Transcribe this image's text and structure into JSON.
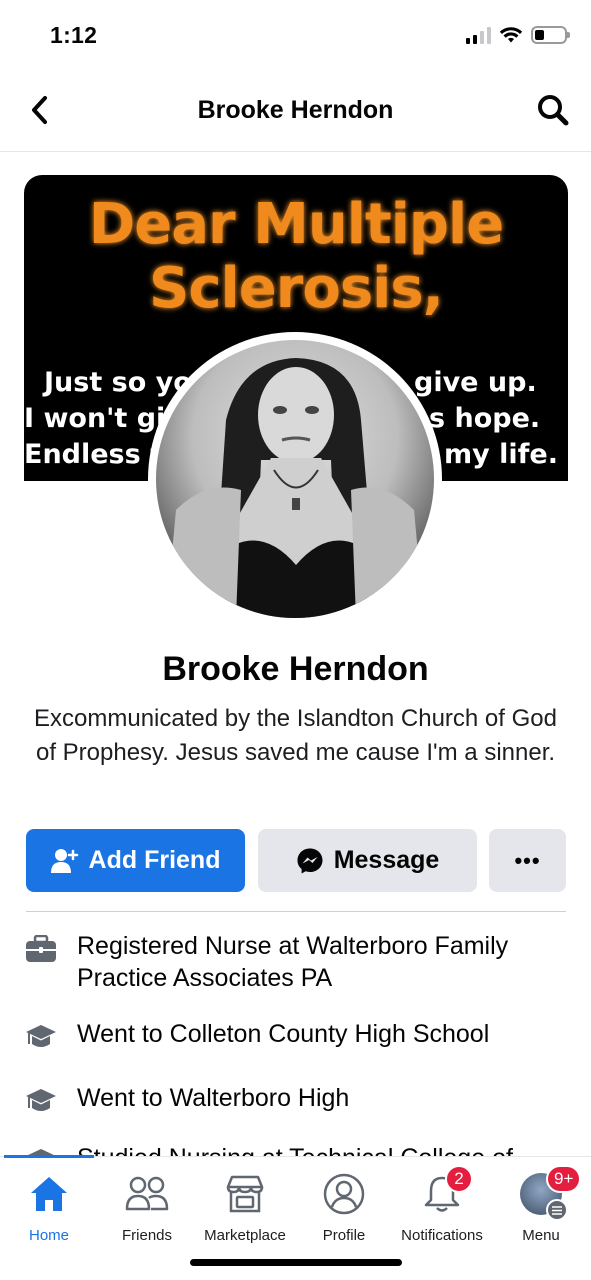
{
  "status_bar": {
    "time": "1:12"
  },
  "header": {
    "title": "Brooke Herndon"
  },
  "cover": {
    "headline_line1": "Dear Multiple",
    "headline_line2": "Sclerosis,",
    "body_line1": "Just so yo",
    "body_line1b": "give up.",
    "body_line2": "I won't giv",
    "body_line2b": "s hope.",
    "body_line3": "Endless f",
    "body_line3b": "my life."
  },
  "profile": {
    "name": "Brooke Herndon",
    "bio": "Excommunicated by the Islandton Church of God of Prophesy. Jesus saved me cause I'm a sinner."
  },
  "actions": {
    "add_friend": "Add Friend",
    "message": "Message",
    "more": "•••"
  },
  "info": [
    {
      "icon": "briefcase-icon",
      "text": "Registered Nurse at Walterboro Family Practice Associates PA"
    },
    {
      "icon": "graduation-cap-icon",
      "text": "Went to Colleton County High School"
    },
    {
      "icon": "graduation-cap-icon",
      "text": "Went to Walterboro High"
    },
    {
      "icon": "graduation-cap-icon",
      "text": "Studied Nursing at Technical College of"
    }
  ],
  "tabs": [
    {
      "label": "Home",
      "active": true
    },
    {
      "label": "Friends"
    },
    {
      "label": "Marketplace"
    },
    {
      "label": "Profile"
    },
    {
      "label": "Notifications",
      "badge": "2"
    },
    {
      "label": "Menu",
      "badge": "9+"
    }
  ],
  "colors": {
    "accent": "#1b74e4",
    "badge": "#e41e3f",
    "cover_orange": "#f08a1c"
  }
}
